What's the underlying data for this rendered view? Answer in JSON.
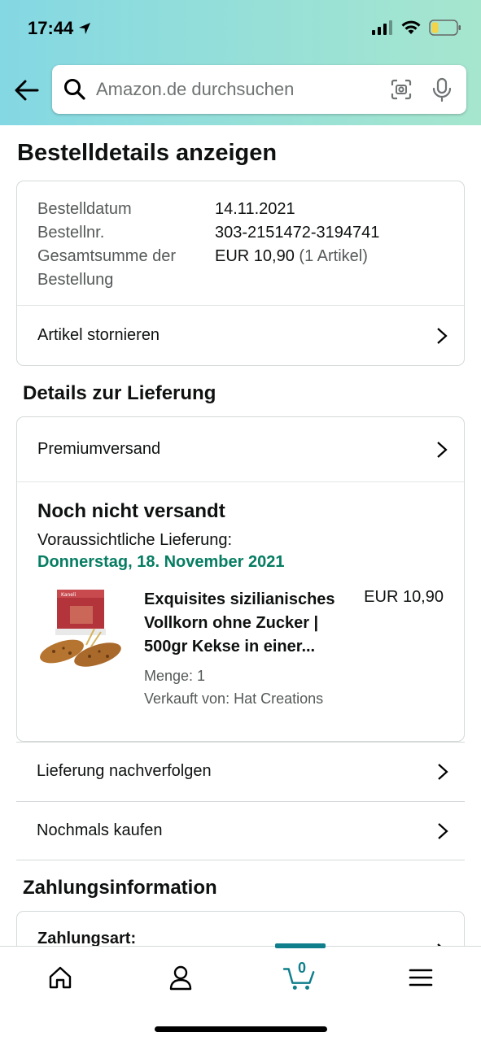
{
  "status_bar": {
    "time": "17:44"
  },
  "search": {
    "placeholder": "Amazon.de durchsuchen"
  },
  "page_title": "Bestelldetails anzeigen",
  "order_info": {
    "rows": [
      {
        "label": "Bestelldatum",
        "value": "14.11.2021",
        "extra": ""
      },
      {
        "label": "Bestellnr.",
        "value": "303-2151472-3194741",
        "extra": ""
      },
      {
        "label": "Gesamtsumme der",
        "value": "EUR 10,90",
        "extra": "(1 Artikel)"
      },
      {
        "label": "Bestellung",
        "value": "",
        "extra": ""
      }
    ],
    "cancel_label": "Artikel stornieren"
  },
  "delivery": {
    "heading": "Details zur Lieferung",
    "shipping_method": "Premiumversand",
    "status": "Noch nicht versandt",
    "eta_label": "Voraussichtliche Lieferung:",
    "eta_date": "Donnerstag, 18. November 2021",
    "item": {
      "title_lines": [
        "Exquisites sizilianisches",
        "Vollkorn ohne Zucker |",
        "500gr Kekse in einer..."
      ],
      "price": "EUR 10,90",
      "quantity": "Menge: 1",
      "seller": "Verkauft von: Hat Creations"
    }
  },
  "actions": {
    "track": "Lieferung nachverfolgen",
    "buy_again": "Nochmals kaufen"
  },
  "payment": {
    "heading": "Zahlungsinformation",
    "method_label": "Zahlungsart:"
  },
  "tabbar": {
    "cart_count": "0",
    "tabs": [
      "home-icon",
      "account-icon",
      "cart-icon",
      "menu-icon"
    ]
  },
  "colors": {
    "accent": "#0f7f8c",
    "eta_green": "#067d62"
  }
}
